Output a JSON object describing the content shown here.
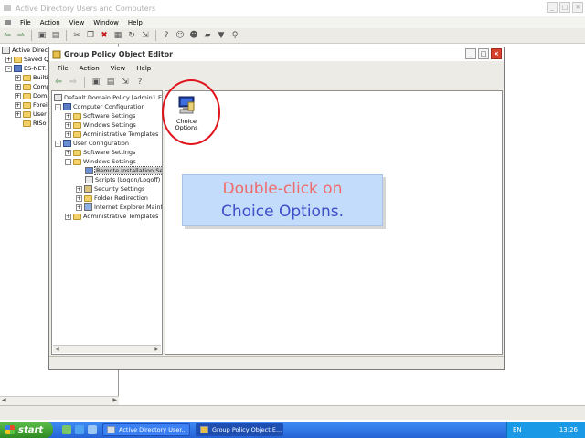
{
  "outer_window": {
    "title": "Active Directory Users and Computers",
    "controls": {
      "minimize": "_",
      "maximize": "□",
      "close": "×"
    },
    "menu": [
      "File",
      "Action",
      "View",
      "Window",
      "Help"
    ],
    "tree": [
      {
        "label": "Active Directo",
        "expander": ""
      },
      {
        "label": "Saved Q",
        "expander": "+"
      },
      {
        "label": "ES-NET.",
        "expander": "-"
      },
      {
        "label": "Builti",
        "expander": "+"
      },
      {
        "label": "Comp",
        "expander": "+"
      },
      {
        "label": "Doma",
        "expander": "+"
      },
      {
        "label": "Forei",
        "expander": "+"
      },
      {
        "label": "User",
        "expander": "+"
      },
      {
        "label": "RISo",
        "expander": ""
      }
    ]
  },
  "gpo_window": {
    "title": "Group Policy Object Editor",
    "controls": {
      "minimize": "_",
      "maximize": "□",
      "close": "×"
    },
    "menu": [
      "File",
      "Action",
      "View",
      "Help"
    ],
    "tree": [
      {
        "label": "Default Domain Policy [admin1.ES-N",
        "expander": "",
        "indent": 0,
        "icon": "policy-icon"
      },
      {
        "label": "Computer Configuration",
        "expander": "-",
        "indent": 1,
        "icon": "computer-icon"
      },
      {
        "label": "Software Settings",
        "expander": "+",
        "indent": 2,
        "icon": "folder-icon"
      },
      {
        "label": "Windows Settings",
        "expander": "+",
        "indent": 2,
        "icon": "folder-icon"
      },
      {
        "label": "Administrative Templates",
        "expander": "+",
        "indent": 2,
        "icon": "folder-icon"
      },
      {
        "label": "User Configuration",
        "expander": "-",
        "indent": 1,
        "icon": "user-config-icon"
      },
      {
        "label": "Software Settings",
        "expander": "+",
        "indent": 2,
        "icon": "folder-icon"
      },
      {
        "label": "Windows Settings",
        "expander": "-",
        "indent": 2,
        "icon": "folder-icon"
      },
      {
        "label": "Remote Installation Ser",
        "expander": "",
        "indent": 3,
        "icon": "remote-install-icon",
        "selected": true
      },
      {
        "label": "Scripts (Logon/Logoff)",
        "expander": "",
        "indent": 3,
        "icon": "script-icon"
      },
      {
        "label": "Security Settings",
        "expander": "+",
        "indent": 3,
        "icon": "security-icon"
      },
      {
        "label": "Folder Redirection",
        "expander": "+",
        "indent": 3,
        "icon": "folder-icon"
      },
      {
        "label": "Internet Explorer Maint",
        "expander": "+",
        "indent": 3,
        "icon": "ie-icon"
      },
      {
        "label": "Administrative Templates",
        "expander": "+",
        "indent": 2,
        "icon": "folder-icon"
      }
    ],
    "right_pane_item": {
      "label_line1": "Choice",
      "label_line2": "Options"
    }
  },
  "callout": {
    "line1": "Double-click on",
    "line2": "Choice Options.",
    "colors": {
      "line1": "#ef6b6b",
      "line2": "#3d4fc9",
      "background": "#c4dcfb",
      "highlight_circle": "#e0141c"
    }
  },
  "taskbar": {
    "start_label": "start",
    "tasks": [
      {
        "label": "Active Directory User...",
        "active": false
      },
      {
        "label": "Group Policy Object E...",
        "active": true
      }
    ],
    "language": "EN",
    "clock": "13:26"
  }
}
